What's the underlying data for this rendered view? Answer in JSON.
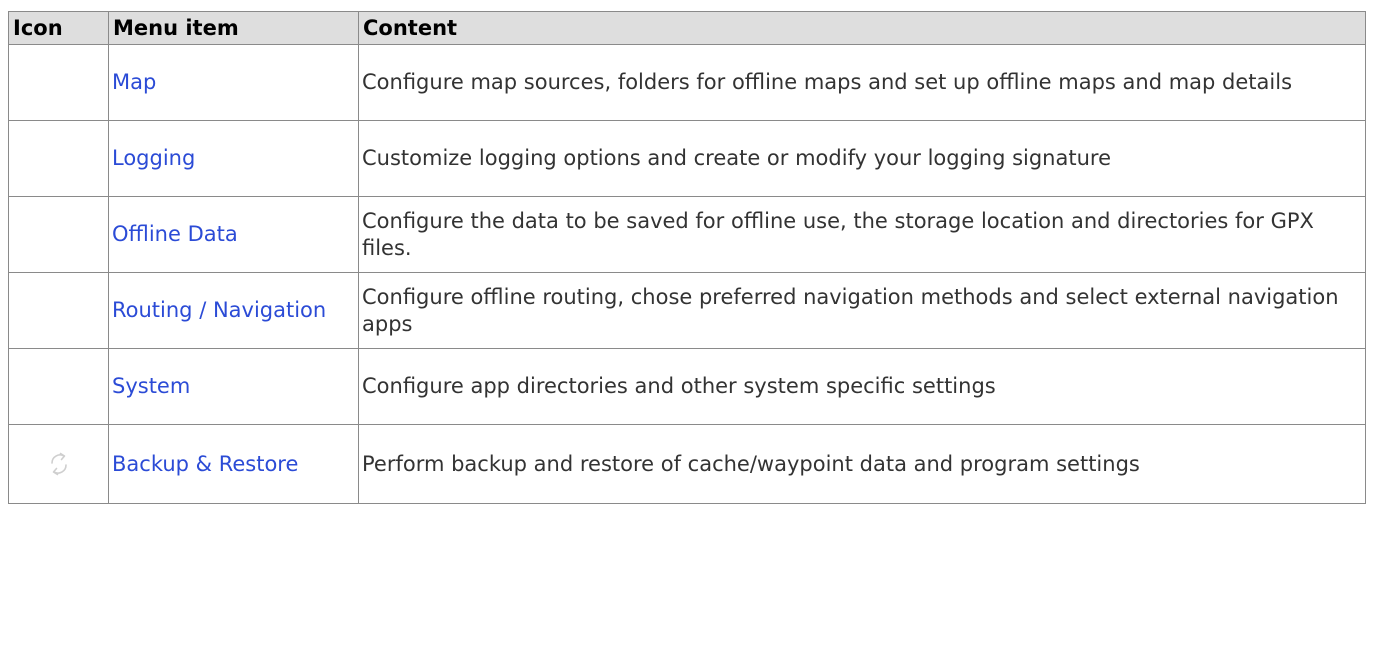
{
  "table": {
    "headers": {
      "icon": "Icon",
      "menu_item": "Menu item",
      "content": "Content"
    },
    "rows": [
      {
        "icon": "",
        "menu_item": "Map",
        "content": "Configure map sources, folders for offline maps and set up offline maps and map details"
      },
      {
        "icon": "",
        "menu_item": "Logging",
        "content": "Customize logging options and create or modify your logging signature"
      },
      {
        "icon": "",
        "menu_item": "Offline Data",
        "content": "Configure the data to be saved for offline use, the storage location and directories for GPX files."
      },
      {
        "icon": "",
        "menu_item": "Routing / Navigation",
        "content": "Configure offline routing, chose preferred navigation methods and select external navigation apps"
      },
      {
        "icon": "",
        "menu_item": "System",
        "content": "Configure app directories and other system specific settings"
      },
      {
        "icon": "sync-arrows-icon",
        "menu_item": "Backup & Restore",
        "content": "Perform backup and restore of cache/waypoint data and program settings"
      }
    ]
  },
  "colors": {
    "link": "#2b4bd6",
    "header_background": "#dedede",
    "border": "#8a8a8a",
    "text": "#333333"
  }
}
